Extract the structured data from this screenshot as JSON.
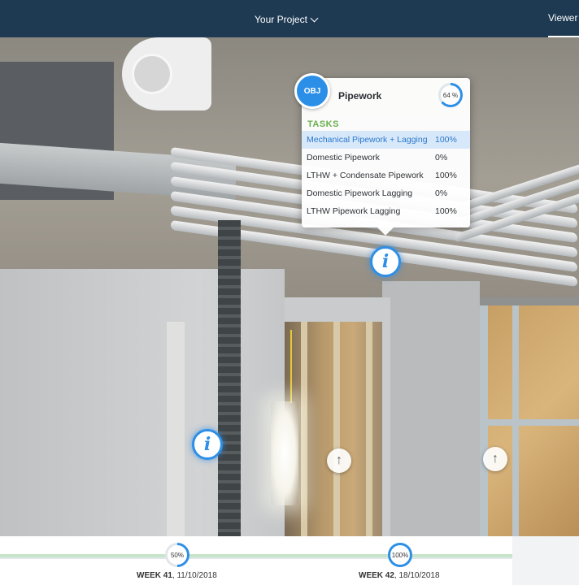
{
  "header": {
    "project_label": "Your Project",
    "viewer_tab": "Viewer"
  },
  "popup": {
    "badge": "OBJ",
    "title": "Pipework",
    "progress_label": "64 %",
    "progress_value": 64,
    "tasks_heading": "TASKS",
    "tasks": [
      {
        "name": "Mechanical Pipework + Lagging",
        "percent": "100%"
      },
      {
        "name": "Domestic Pipework",
        "percent": "0%"
      },
      {
        "name": "LTHW + Condensate Pipework",
        "percent": "100%"
      },
      {
        "name": "Domestic Pipework Lagging",
        "percent": "0%"
      },
      {
        "name": "LTHW Pipework Lagging",
        "percent": "100%"
      }
    ]
  },
  "hotspots": {
    "info_glyph": "i",
    "arrow_glyph": "↑"
  },
  "timeline": {
    "weeks": [
      {
        "week": "WEEK 41",
        "date": ", 11/10/2018",
        "progress_label": "50%",
        "progress_value": 50
      },
      {
        "week": "WEEK 42",
        "date": ", 18/10/2018",
        "progress_label": "100%",
        "progress_value": 100
      }
    ]
  },
  "colors": {
    "accent": "#2e8fe6",
    "tasks_heading": "#6ab04c",
    "header_bg": "#1e3a52",
    "active_row": "#d7e8fb"
  }
}
